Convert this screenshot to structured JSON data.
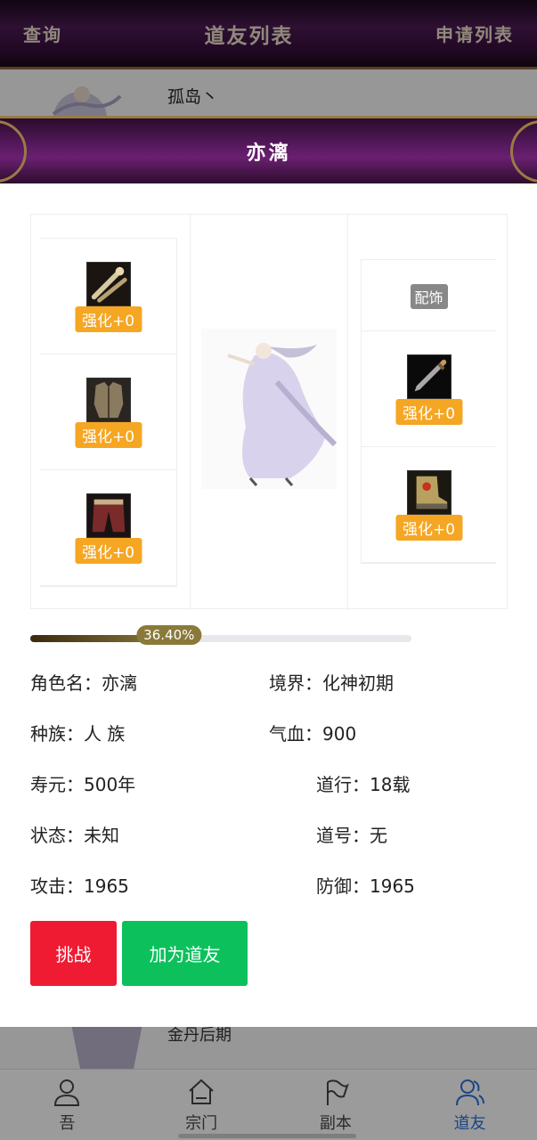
{
  "background": {
    "banner": {
      "left": "查询",
      "title": "道友列表",
      "right": "申请列表"
    },
    "friend_top": {
      "name": "孤岛丶"
    },
    "friend_bottom": {
      "realm": "金丹后期"
    }
  },
  "tabbar": [
    {
      "label": "吾",
      "icon": "person-icon"
    },
    {
      "label": "宗门",
      "icon": "home-icon"
    },
    {
      "label": "副本",
      "icon": "flag-icon"
    },
    {
      "label": "道友",
      "icon": "friends-icon",
      "active": true
    }
  ],
  "modal": {
    "title": "亦漓",
    "left_slots": [
      {
        "enhance": "强化+0",
        "icon": "bone-weapon-icon"
      },
      {
        "enhance": "强化+0",
        "icon": "armor-icon"
      },
      {
        "enhance": "强化+0",
        "icon": "pants-icon"
      }
    ],
    "right_slots": [
      {
        "label": "配饰"
      },
      {
        "enhance": "强化+0",
        "icon": "dagger-icon"
      },
      {
        "enhance": "强化+0",
        "icon": "boots-icon"
      }
    ],
    "progress": {
      "value": 36.4,
      "label": "36.40%"
    },
    "info": {
      "name": "角色名：亦漓",
      "realm": "境界：化神初期",
      "race": "种族：人 族",
      "hp": "气血：900",
      "lifespan": "寿元：500年",
      "dao": "道行：18载",
      "status": "状态：未知",
      "title": "道号：无",
      "attack": "攻击：1965",
      "defense": "防御：1965"
    },
    "buttons": {
      "challenge": "挑战",
      "add_friend": "加为道友"
    }
  },
  "colors": {
    "accent": "#2b6fd6",
    "enhance_badge": "#f5a623",
    "challenge": "#ee1b33",
    "add": "#0cc15c"
  }
}
